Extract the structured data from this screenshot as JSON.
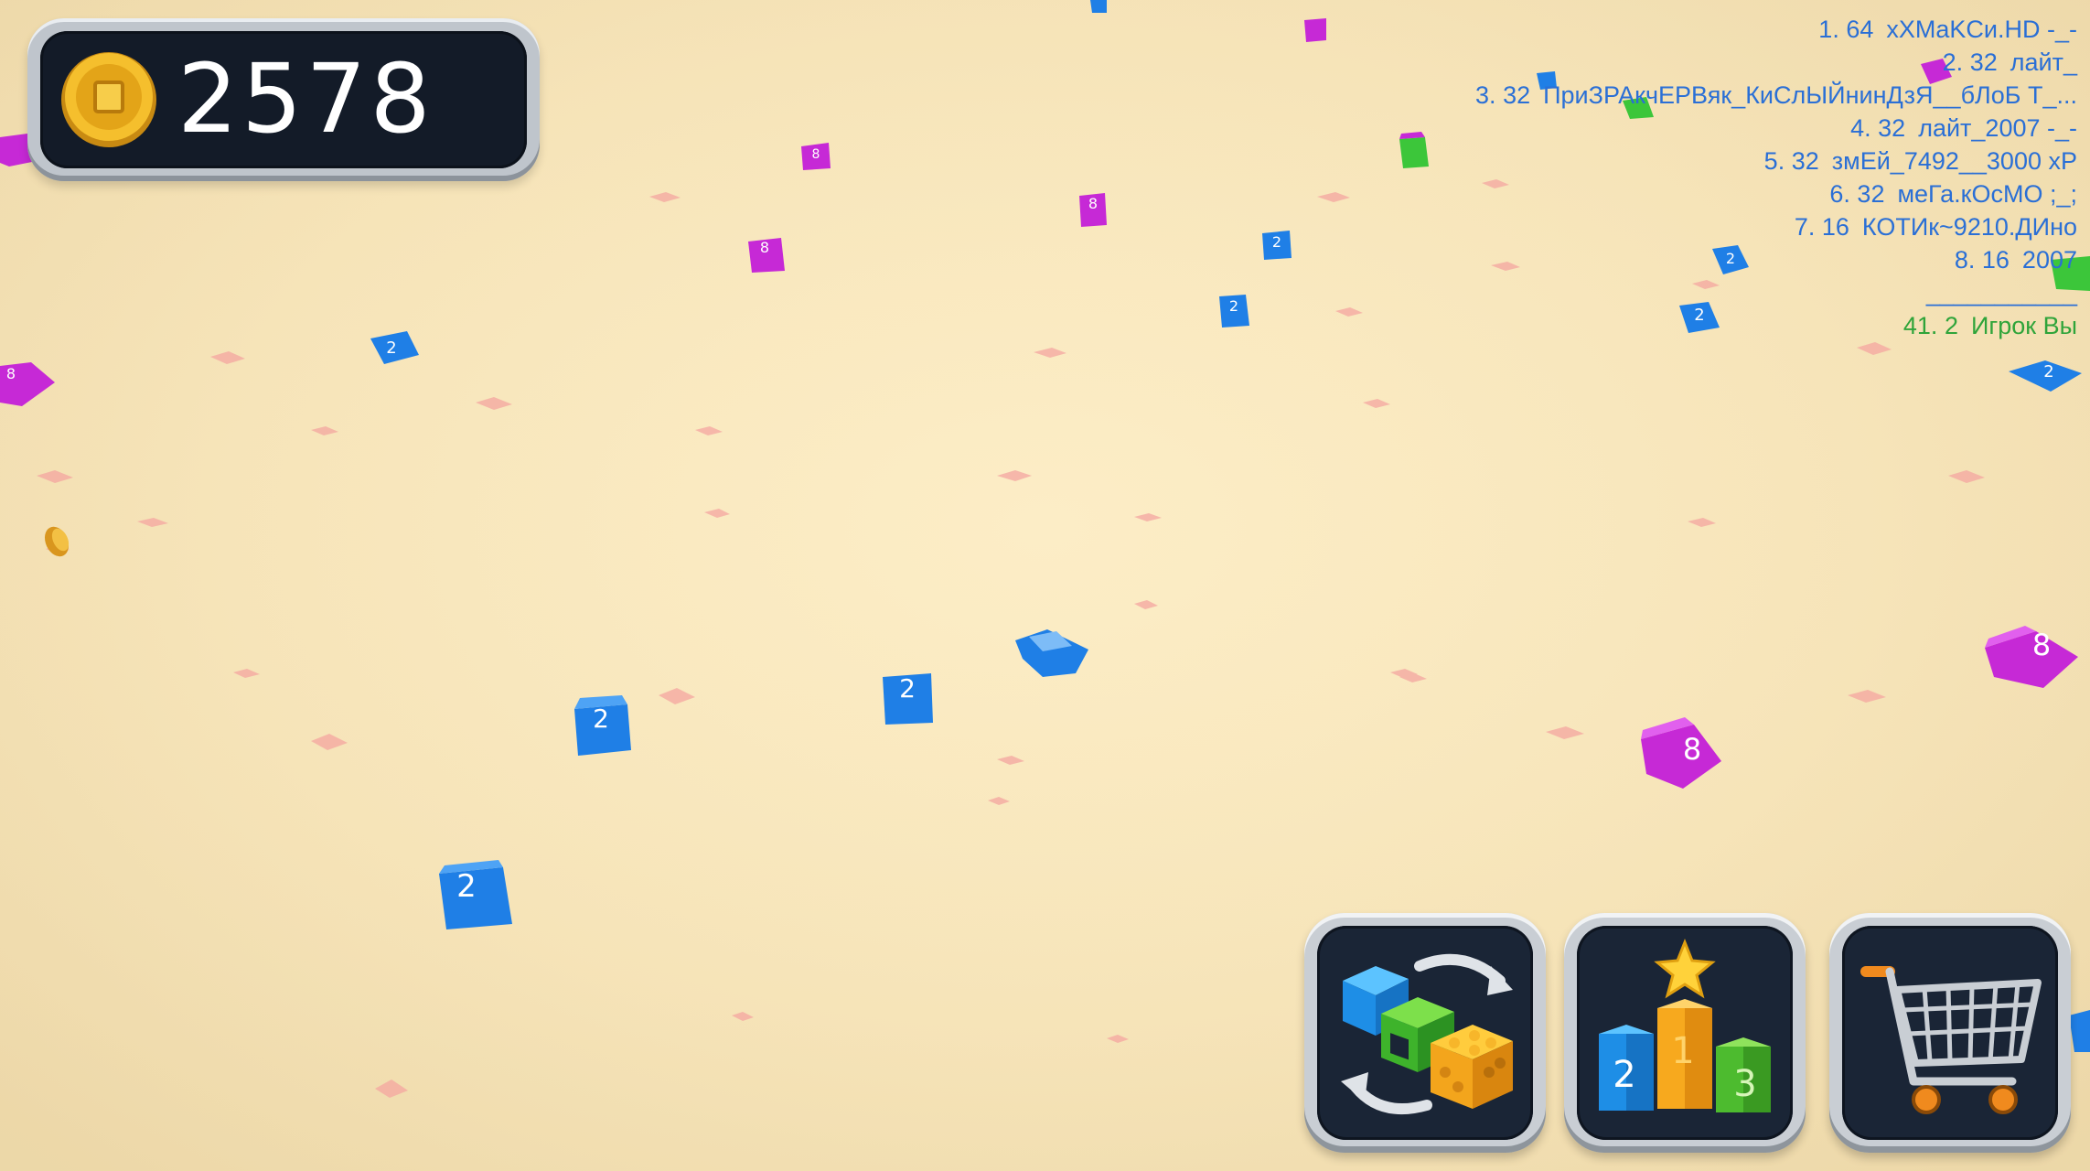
{
  "coins": {
    "value": "2578",
    "icon": "gold-coin-icon"
  },
  "leaderboard": {
    "entries": [
      {
        "rank": "1.",
        "score": "64",
        "name": "xXMaKCи.HD -_-"
      },
      {
        "rank": "2.",
        "score": "32",
        "name": "лайт_"
      },
      {
        "rank": "3.",
        "score": "32",
        "name": "ПриЗРАкчЕРВяк_КиСлЫЙнинДзЯ__бЛоБ Т_..."
      },
      {
        "rank": "4.",
        "score": "32",
        "name": "лайт_2007 -_-"
      },
      {
        "rank": "5.",
        "score": "32",
        "name": "змЕй_7492__3000 хР"
      },
      {
        "rank": "6.",
        "score": "32",
        "name": "меГа.кОсМО ;_;"
      },
      {
        "rank": "7.",
        "score": "16",
        "name": "КОТИк~9210.ДИно"
      },
      {
        "rank": "8.",
        "score": "16",
        "name": "2007"
      }
    ],
    "separator": "___________",
    "player": {
      "rank": "41.",
      "score": "2",
      "name": "Игрок Вы"
    }
  },
  "buttons": {
    "skins": {
      "icon": "cube-skins-swap-icon"
    },
    "leaders": {
      "icon": "podium-leaderboard-icon"
    },
    "shop": {
      "icon": "shopping-cart-icon"
    }
  },
  "field": {
    "cube_labels": {
      "blue": "2",
      "magenta": "8"
    },
    "colors": {
      "ground": "#f8e6bb",
      "blue_cube": "#1f7fe6",
      "magenta_cube": "#c629d6",
      "green_cube": "#3cc63a",
      "marker": "#f4a6a0",
      "player_text": "#2fa43a",
      "leader_text": "#2a6fd6"
    }
  }
}
